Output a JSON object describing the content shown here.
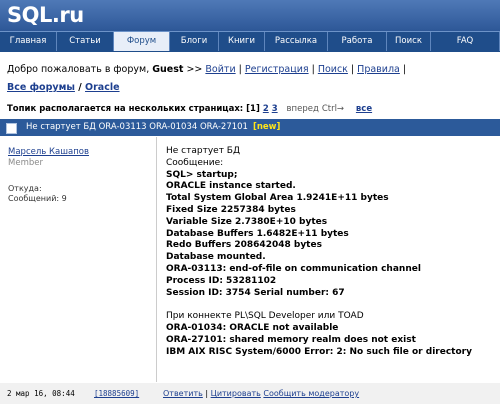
{
  "header": {
    "logo": "SQL.ru"
  },
  "nav": {
    "items": [
      "Главная",
      "Статьи",
      "Форум",
      "Блоги",
      "Книги",
      "Рассылка",
      "Работа",
      "Поиск",
      "FAQ"
    ],
    "active_index": 2
  },
  "welcome": {
    "prefix": "Добро пожаловать в форум, ",
    "user": "Guest",
    "sep": " >> ",
    "links": [
      "Войти",
      "Регистрация",
      "Поиск",
      "Правила"
    ]
  },
  "breadcrumb": {
    "items": [
      "Все форумы",
      "Oracle"
    ],
    "sep": " / "
  },
  "pages": {
    "label": "Топик располагается на нескольких страницах: ",
    "current": "[1]",
    "others": [
      "2",
      "3"
    ],
    "next": "вперед",
    "ctrl": "Ctrl→",
    "all": "все"
  },
  "topic": {
    "title": "Не стартует БД  ORA-03113 ORA-01034 ORA-27101",
    "badge": "[new]"
  },
  "post": {
    "author": "Марсель Кашапов",
    "role": "Member",
    "from_label": "Откуда:",
    "messages_label": "Сообщений: 9",
    "lines": [
      {
        "text": "Не стартует БД",
        "bold": false
      },
      {
        "text": "Сообщение:",
        "bold": false
      },
      {
        "text": "SQL> startup;",
        "bold": true
      },
      {
        "text": "ORACLE instance started.",
        "bold": true
      },
      {
        "text": "Total System Global Area 1.9241E+11 bytes",
        "bold": true
      },
      {
        "text": "Fixed Size 2257384 bytes",
        "bold": true
      },
      {
        "text": "Variable Size 2.7380E+10 bytes",
        "bold": true
      },
      {
        "text": "Database Buffers 1.6482E+11 bytes",
        "bold": true
      },
      {
        "text": "Redo Buffers 208642048 bytes",
        "bold": true
      },
      {
        "text": "Database mounted.",
        "bold": true
      },
      {
        "text": "ORA-03113: end-of-file on communication channel",
        "bold": true
      },
      {
        "text": "Process ID: 53281102",
        "bold": true
      },
      {
        "text": "Session ID: 3754 Serial number: 67",
        "bold": true
      },
      {
        "text": "",
        "bold": false
      },
      {
        "text": "При коннекте PL\\SQL Developer или TOAD",
        "bold": false
      },
      {
        "text": "ORA-01034: ORACLE not available",
        "bold": true
      },
      {
        "text": "ORA-27101: shared memory realm does not exist",
        "bold": true
      },
      {
        "text": "IBM AIX RISC System/6000 Error: 2: No such file or directory",
        "bold": true
      }
    ]
  },
  "footer": {
    "date": "2 мар 16, 08:44",
    "post_id": "[18885609]",
    "reply": "Ответить",
    "quote": "Цитировать",
    "report": "Сообщить модератору"
  }
}
